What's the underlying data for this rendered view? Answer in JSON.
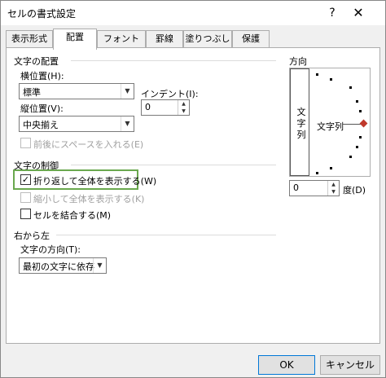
{
  "window": {
    "title": "セルの書式設定",
    "help": "?",
    "close": "✕"
  },
  "tabs": [
    {
      "label": "表示形式"
    },
    {
      "label": "配置"
    },
    {
      "label": "フォント"
    },
    {
      "label": "罫線"
    },
    {
      "label": "塗りつぶし"
    },
    {
      "label": "保護"
    }
  ],
  "alignment": {
    "section_title": "文字の配置",
    "horizontal_label": "横位置(H):",
    "horizontal_value": "標準",
    "indent_label": "インデント(I):",
    "indent_value": "0",
    "vertical_label": "縦位置(V):",
    "vertical_value": "中央揃え",
    "justify_distributed_label": "前後にスペースを入れる(E)"
  },
  "text_control": {
    "section_title": "文字の制御",
    "wrap_text_label": "折り返して全体を表示する(W)",
    "wrap_text_checked": "✓",
    "shrink_to_fit_label": "縮小して全体を表示する(K)",
    "merge_cells_label": "セルを結合する(M)"
  },
  "rtl": {
    "section_title": "右から左",
    "direction_label": "文字の方向(T):",
    "direction_value": "最初の文字に依存"
  },
  "orientation": {
    "section_title": "方向",
    "vertical_text": "文字列",
    "dial_label": "文字列",
    "degrees_value": "0",
    "degrees_label": "度(D)"
  },
  "footer": {
    "ok_label": "OK",
    "cancel_label": "キャンセル"
  }
}
